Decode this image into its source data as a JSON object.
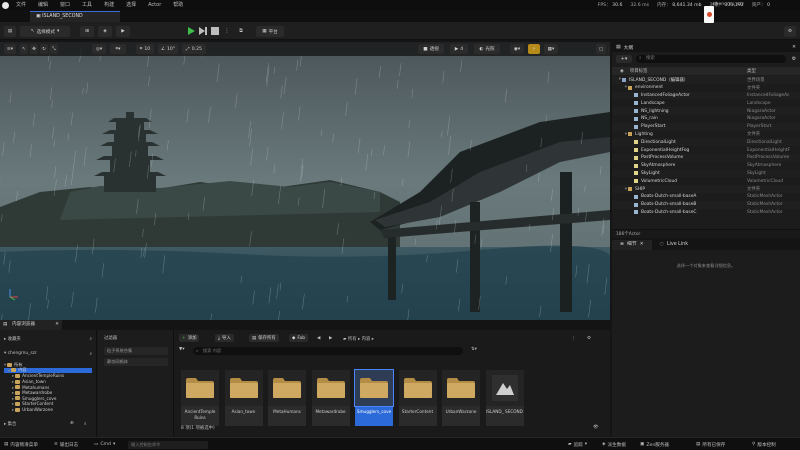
{
  "menu": {
    "items": [
      "文件",
      "编辑",
      "窗口",
      "工具",
      "构建",
      "选择",
      "Actor",
      "帮助"
    ]
  },
  "stats": {
    "fps_label": "FPS",
    "fps_value": "30.6",
    "frame_ms": "32.6 ms",
    "mem": "8,641.34 mb",
    "objects_label": "对象",
    "objects_value": "131,192",
    "assets_label": "资产",
    "assets_value": "0"
  },
  "user": {
    "name": "chengmu_szr"
  },
  "tabs": {
    "document": "ISLAND_SECOND"
  },
  "toolbar": {
    "mode_label": "选择模式",
    "platform_label": "平台"
  },
  "viewport": {
    "perspective_label": "透视",
    "lit_label": "光照",
    "snap_grid": "10",
    "snap_angle": "10°",
    "snap_scale": "0.25",
    "camera_speed": "4"
  },
  "outliner": {
    "title": "大纲",
    "search_placeholder": "搜索",
    "col_label": "项目标签",
    "col_type": "类型",
    "rows": [
      {
        "name": "ISLAND_SECOND（编辑器）",
        "type": "世界场景",
        "indent": 1,
        "kind": "world"
      },
      {
        "name": "environment",
        "type": "文件夹",
        "indent": 2,
        "kind": "folder"
      },
      {
        "name": "InstancedFoliageActor",
        "type": "InstancedFoliageAc",
        "indent": 3,
        "kind": "actor"
      },
      {
        "name": "Landscape",
        "type": "Landscape",
        "indent": 3,
        "kind": "actor"
      },
      {
        "name": "NS_lightning",
        "type": "NiagaraActor",
        "indent": 3,
        "kind": "actor"
      },
      {
        "name": "NS_rain",
        "type": "NiagaraActor",
        "indent": 3,
        "kind": "actor"
      },
      {
        "name": "PlayerStart",
        "type": "PlayerStart",
        "indent": 3,
        "kind": "actor"
      },
      {
        "name": "Lighting",
        "type": "文件夹",
        "indent": 2,
        "kind": "folder"
      },
      {
        "name": "DirectionalLight",
        "type": "DirectionalLight",
        "indent": 3,
        "kind": "light"
      },
      {
        "name": "ExponentialHeightFog",
        "type": "ExponentialHeightF",
        "indent": 3,
        "kind": "light"
      },
      {
        "name": "PostProcessVolume",
        "type": "PostProcessVolume",
        "indent": 3,
        "kind": "light"
      },
      {
        "name": "SkyAtmosphere",
        "type": "SkyAtmosphere",
        "indent": 3,
        "kind": "light"
      },
      {
        "name": "SkyLight",
        "type": "SkyLight",
        "indent": 3,
        "kind": "light"
      },
      {
        "name": "VolumetricCloud",
        "type": "VolumetricCloud",
        "indent": 3,
        "kind": "light"
      },
      {
        "name": "SHIP",
        "type": "文件夹",
        "indent": 2,
        "kind": "folder"
      },
      {
        "name": "Boats-Dutch-small-baseA",
        "type": "StaticMeshActor",
        "indent": 3,
        "kind": "actor"
      },
      {
        "name": "Boats-Dutch-small-baseB",
        "type": "StaticMeshActor",
        "indent": 3,
        "kind": "actor"
      },
      {
        "name": "Boats-Dutch-small-baseC",
        "type": "StaticMeshActor",
        "indent": 3,
        "kind": "actor"
      }
    ],
    "footer": "186个Actor"
  },
  "details": {
    "tab_details": "细节",
    "tab_livelink": "Live Link",
    "empty_text": "选择一个对象来查看详细信息。"
  },
  "content_browser": {
    "tab_title": "内容浏览器",
    "favorites_label": "收藏夹",
    "project_label": "chengmu_szr",
    "tree": [
      {
        "name": "所有",
        "indent": 0
      },
      {
        "name": "内容",
        "indent": 1,
        "selected": true
      },
      {
        "name": "AncientTempleRuins",
        "indent": 2
      },
      {
        "name": "Asian_town",
        "indent": 2
      },
      {
        "name": "Metahumans",
        "indent": 2
      },
      {
        "name": "Metawardrobe",
        "indent": 2
      },
      {
        "name": "Smugglers_cove",
        "indent": 2
      },
      {
        "name": "StarterContent",
        "indent": 2
      },
      {
        "name": "UrbanWarzone",
        "indent": 2
      }
    ],
    "collections_label": "集合",
    "filters_title": "过滤器",
    "filters": [
      "粒子系统合集",
      "静态网格体"
    ],
    "add_label": "添加",
    "import_label": "导入",
    "save_all_label": "保存所有",
    "fab_label": "Fab",
    "path": [
      "所有",
      "内容"
    ],
    "search_placeholder": "搜索 内容",
    "items": [
      {
        "label": "AncientTemple Ruins",
        "kind": "folder"
      },
      {
        "label": "Asian_town",
        "kind": "folder"
      },
      {
        "label": "MetaHumans",
        "kind": "folder"
      },
      {
        "label": "Metawardrobe",
        "kind": "folder"
      },
      {
        "label": "Smugglers_cove",
        "kind": "folder",
        "selected": true
      },
      {
        "label": "StarterContent",
        "kind": "folder"
      },
      {
        "label": "UrbanWarzone",
        "kind": "folder"
      },
      {
        "label": "ISLAND_ SECOND",
        "kind": "level"
      }
    ],
    "status": "8 项(1 项被选中)"
  },
  "statusbar": {
    "content_drawer": "内容侧滑菜单",
    "output_log": "输出日志",
    "cmd_label": "Cmd",
    "cmd_placeholder": "输入控制台命令",
    "trace_label": "追踪",
    "derived_data": "派生数据",
    "zen_label": "Zen服务器",
    "all_saved": "所有已保存",
    "source_control": "版本控制"
  },
  "colors": {
    "accent": "#3a6fd8",
    "selection": "#2d6ad9",
    "folder": "#c9a35a",
    "play_green": "#3fbf4a"
  }
}
